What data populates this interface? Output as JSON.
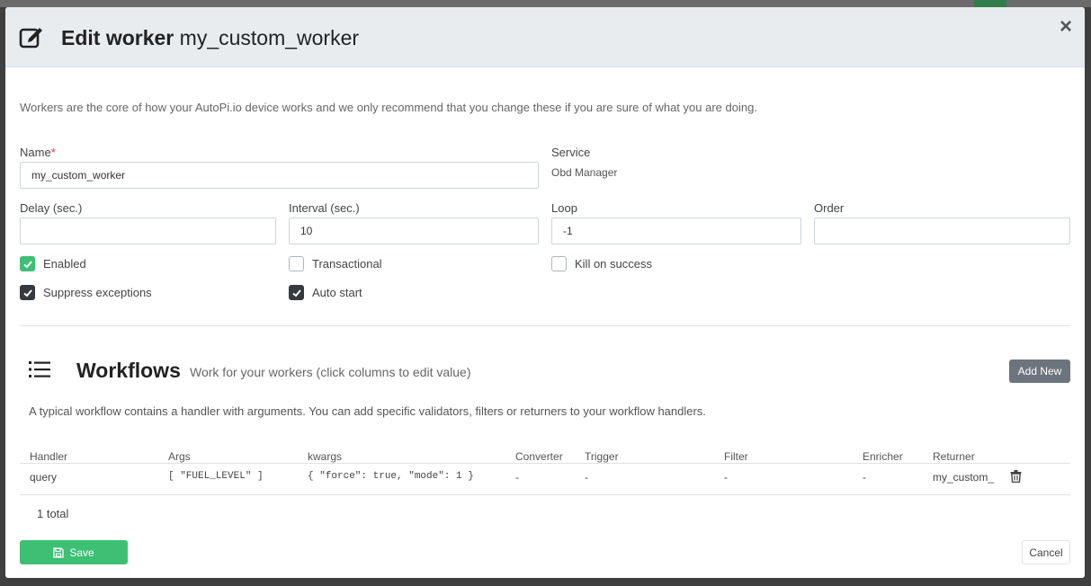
{
  "modal": {
    "title_bold": "Edit worker",
    "title_name": "my_custom_worker",
    "close_label": "×"
  },
  "intro": "Workers are the core of how your AutoPi.io device works and we only recommend that you change these if you are sure of what you are doing.",
  "form": {
    "name_label": "Name",
    "name_required": "*",
    "name_value": "my_custom_worker",
    "service_label": "Service",
    "service_value": "Obd Manager",
    "delay_label": "Delay (sec.)",
    "delay_value": "",
    "interval_label": "Interval (sec.)",
    "interval_value": "10",
    "loop_label": "Loop",
    "loop_value": "-1",
    "order_label": "Order",
    "order_value": ""
  },
  "checkboxes": {
    "enabled": {
      "label": "Enabled",
      "checked": true
    },
    "transactional": {
      "label": "Transactional",
      "checked": false
    },
    "kill_on_success": {
      "label": "Kill on success",
      "checked": false
    },
    "suppress_exceptions": {
      "label": "Suppress exceptions",
      "checked": true
    },
    "auto_start": {
      "label": "Auto start",
      "checked": true
    }
  },
  "workflows": {
    "title": "Workflows",
    "subtitle": "Work for your workers (click columns to edit value)",
    "add_new_label": "Add New",
    "description": "A typical workflow contains a handler with arguments. You can add specific validators, filters or returners to your workflow handlers.",
    "columns": [
      "Handler",
      "Args",
      "kwargs",
      "Converter",
      "Trigger",
      "Filter",
      "Enricher",
      "Returner"
    ],
    "rows": [
      {
        "handler": "query",
        "args": "[ \"FUEL_LEVEL\" ]",
        "kwargs": "{ \"force\": true, \"mode\": 1 }",
        "converter": "-",
        "trigger": "-",
        "filter": "-",
        "enricher": "-",
        "returner": "my_custom_"
      }
    ],
    "total": "1 total"
  },
  "footer": {
    "save_label": "Save",
    "cancel_label": "Cancel"
  },
  "colors": {
    "primary_green": "#3dbf74",
    "secondary_gray": "#6c757d",
    "header_bg": "#e9ecef"
  }
}
